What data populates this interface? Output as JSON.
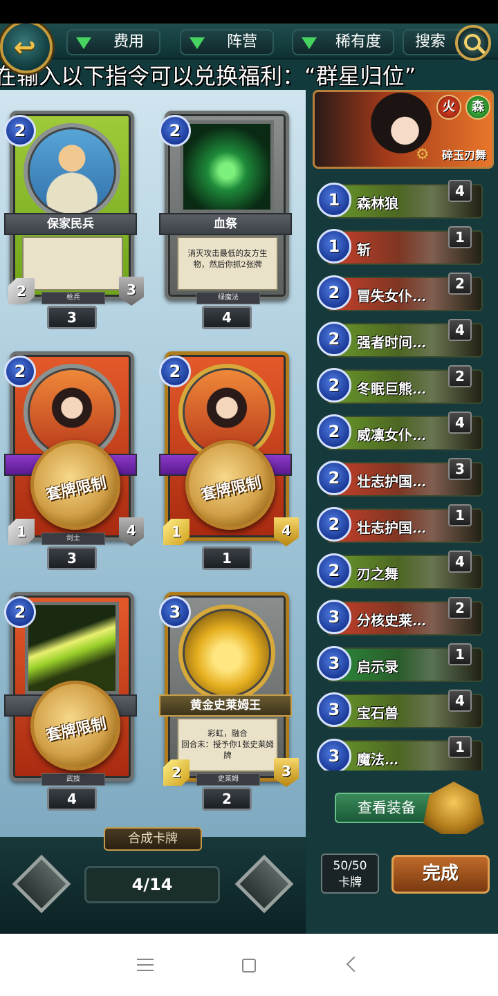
{
  "topbar": {
    "filters": [
      {
        "label": "费用"
      },
      {
        "label": "阵营"
      },
      {
        "label": "稀有度"
      }
    ],
    "search_label": "搜索"
  },
  "banner": "在输入以下指令可以兑换福利：“群星归位”",
  "cards": [
    {
      "name": "保家民兵",
      "cost": "2",
      "attack": "2",
      "health": "3",
      "subtype": "枪兵",
      "count": "3",
      "text": ""
    },
    {
      "name": "血祭",
      "cost": "2",
      "subtype": "绿魔法",
      "count": "4",
      "text": "消灭攻击最低的友方生物，然后你抓2张牌"
    },
    {
      "name": "",
      "cost": "2",
      "attack": "1",
      "health": "4",
      "subtype": "剑士",
      "count": "3",
      "seal": "套牌限制"
    },
    {
      "name": "",
      "cost": "2",
      "attack": "1",
      "health": "4",
      "subtype": "",
      "count": "1",
      "seal": "套牌限制"
    },
    {
      "name": "",
      "cost": "2",
      "subtype": "武技",
      "count": "4",
      "seal": "套牌限制"
    },
    {
      "name": "黄金史莱姆王",
      "cost": "3",
      "attack": "2",
      "health": "3",
      "subtype": "史莱姆",
      "count": "2",
      "text": "彩虹，融合\n回合末：授予你1张史莱姆牌"
    }
  ],
  "craft_label": "合成卡牌",
  "pager": "4/14",
  "hero": {
    "name": "碎玉刃舞",
    "elements": [
      "火",
      "森"
    ]
  },
  "deck": [
    {
      "cost": "1",
      "name": "森林狼",
      "qty": "4",
      "color": "#6a9a2a"
    },
    {
      "cost": "1",
      "name": "斩",
      "qty": "1",
      "color": "#c8402a"
    },
    {
      "cost": "2",
      "name": "冒失女仆…",
      "qty": "2",
      "color": "#c8402a"
    },
    {
      "cost": "2",
      "name": "强者时间…",
      "qty": "4",
      "color": "#6a9a2a"
    },
    {
      "cost": "2",
      "name": "冬眠巨熊…",
      "qty": "2",
      "color": "#6a9a2a"
    },
    {
      "cost": "2",
      "name": "威凛女仆…",
      "qty": "4",
      "color": "#6a9a2a"
    },
    {
      "cost": "2",
      "name": "壮志护国…",
      "qty": "3",
      "color": "#c8402a"
    },
    {
      "cost": "2",
      "name": "壮志护国…",
      "qty": "1",
      "color": "#c8402a"
    },
    {
      "cost": "2",
      "name": "刃之舞",
      "qty": "4",
      "color": "#6a9a2a"
    },
    {
      "cost": "3",
      "name": "分核史莱…",
      "qty": "2",
      "color": "#c8402a"
    },
    {
      "cost": "3",
      "name": "启示录",
      "qty": "1",
      "color": "#2a8a3a"
    },
    {
      "cost": "3",
      "name": "宝石兽",
      "qty": "4",
      "color": "#6a9a2a"
    },
    {
      "cost": "3",
      "name": "魔法…",
      "qty": "1",
      "color": "#6a9a2a"
    }
  ],
  "equip_label": "查看装备",
  "deck_count": {
    "value": "50/50",
    "label": "卡牌"
  },
  "done_label": "完成",
  "colors": {
    "accent_gold": "#c59a3a",
    "cost_blue": "#1b3a98",
    "panel": "#163a3c"
  }
}
